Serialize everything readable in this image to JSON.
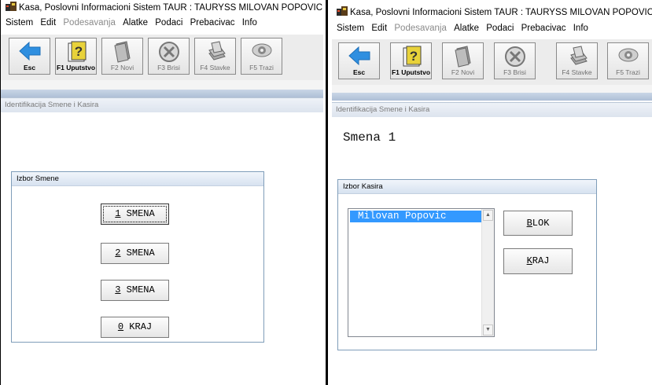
{
  "left": {
    "title": "Kasa, Poslovni Informacioni Sistem TAUR : TAURYSS MILOVAN POPOVIC PR,",
    "menu": [
      {
        "label": "Sistem",
        "enabled": true
      },
      {
        "label": "Edit",
        "enabled": true
      },
      {
        "label": "Podesavanja",
        "enabled": false
      },
      {
        "label": "Alatke",
        "enabled": true
      },
      {
        "label": "Podaci",
        "enabled": true
      },
      {
        "label": "Prebacivac",
        "enabled": true
      },
      {
        "label": "Info",
        "enabled": true
      }
    ],
    "toolbar": {
      "esc": "Esc",
      "f1": "F1 Uputstvo",
      "f2": "F2 Novi",
      "f3": "F3 Brisi",
      "f4": "F4 Stavke",
      "f5": "F5 Trazi"
    },
    "form_caption": "Identifikacija Smene i Kasira",
    "group_title": "Izbor Smene",
    "buttons": [
      {
        "hotkey": "1",
        "text": " SMENA"
      },
      {
        "hotkey": "2",
        "text": " SMENA"
      },
      {
        "hotkey": "3",
        "text": " SMENA"
      },
      {
        "hotkey": "0",
        "text": " KRAJ"
      }
    ]
  },
  "right": {
    "title": "Kasa, Poslovni Informacioni Sistem TAUR : TAURYSS MILOVAN POPOVIC PR,",
    "menu": [
      {
        "label": "Sistem",
        "enabled": true
      },
      {
        "label": "Edit",
        "enabled": true
      },
      {
        "label": "Podesavanja",
        "enabled": false
      },
      {
        "label": "Alatke",
        "enabled": true
      },
      {
        "label": "Podaci",
        "enabled": true
      },
      {
        "label": "Prebacivac",
        "enabled": true
      },
      {
        "label": "Info",
        "enabled": true
      }
    ],
    "toolbar": {
      "esc": "Esc",
      "f1": "F1 Uputstvo",
      "f2": "F2 Novi",
      "f3": "F3 Brisi",
      "f4": "F4 Stavke",
      "f5": "F5 Trazi"
    },
    "form_caption": "Identifikacija Smene i Kasira",
    "shift_label": "Smena 1",
    "group_title": "Izbor Kasira",
    "cashiers": [
      "Milovan Popovic"
    ],
    "buttons": {
      "blok": {
        "hotkey": "B",
        "text": "LOK"
      },
      "kraj": {
        "hotkey": "K",
        "text": "RAJ"
      }
    }
  },
  "colors": {
    "selection": "#3399ff",
    "toolbar_bg": "#ececec",
    "esc_arrow": "#2f8fe0",
    "help_icon": "#e8d23a"
  },
  "icons": {
    "app": "app-icon",
    "esc": "arrow-left-icon",
    "f1": "help-question-icon",
    "f2": "new-document-icon",
    "f3": "delete-x-icon",
    "f4": "document-stack-icon",
    "f5": "eye-search-icon"
  }
}
